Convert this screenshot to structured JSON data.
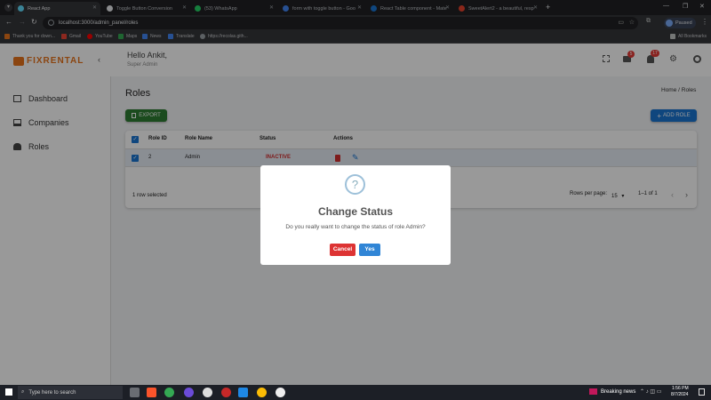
{
  "browser": {
    "tabs": [
      {
        "title": "React App",
        "active": true,
        "color": "#61dafb"
      },
      {
        "title": "Toggle Button Conversion",
        "active": false,
        "color": "#e8eaed"
      },
      {
        "title": "(53) WhatsApp",
        "active": false,
        "color": "#25d366"
      },
      {
        "title": "form with toggle button - Goo",
        "active": false,
        "color": "#4285f4"
      },
      {
        "title": "React Table component - Mate",
        "active": false,
        "color": "#1976d2"
      },
      {
        "title": "SweetAlert2 - a beautiful, resp",
        "active": false,
        "color": "#e8412c"
      }
    ],
    "url": "localhost:3000/admin_panel/roles",
    "profile_label": "Paused",
    "bookmarks": [
      "Thank you for down...",
      "Gmail",
      "YouTube",
      "Maps",
      "News",
      "Translate",
      "https://recolas.gith..."
    ],
    "all_bookmarks": "All Bookmarks"
  },
  "header": {
    "brand": "FIXRENTAL",
    "greeting": "Hello Ankit,",
    "role": "Super Admin",
    "mail_badge": "5",
    "notif_badge": "17"
  },
  "sidebar": {
    "items": [
      {
        "label": "Dashboard",
        "icon": "dashboard-icon"
      },
      {
        "label": "Companies",
        "icon": "companies-icon"
      },
      {
        "label": "Roles",
        "icon": "roles-icon"
      }
    ]
  },
  "page": {
    "title": "Roles",
    "breadcrumb_home": "Home",
    "breadcrumb_sep": " / ",
    "breadcrumb_current": "Roles",
    "export_label": "EXPORT",
    "add_label": "ADD ROLE"
  },
  "table": {
    "columns": [
      "Role ID",
      "Role Name",
      "Status",
      "Actions"
    ],
    "rows": [
      {
        "id": "2",
        "name": "Admin",
        "status": "INACTIVE"
      }
    ],
    "selected_text": "1 row selected",
    "rows_per_page_label": "Rows per page:",
    "rows_per_page": "15",
    "range": "1–1 of 1"
  },
  "modal": {
    "icon": "?",
    "title": "Change Status",
    "message": "Do you really want to change the status of role Admin?",
    "cancel": "Cancel",
    "confirm": "Yes"
  },
  "taskbar": {
    "search_placeholder": "Type here to search",
    "news": "Breaking news",
    "time": "1:56 PM",
    "date": "8/7/2024"
  },
  "colors": {
    "brand_orange": "#e8741c",
    "export_green": "#2e7d32",
    "primary_blue": "#1976d2",
    "inactive_red": "#d32f2f",
    "cancel_red": "#d33",
    "confirm_blue": "#3085d6"
  }
}
